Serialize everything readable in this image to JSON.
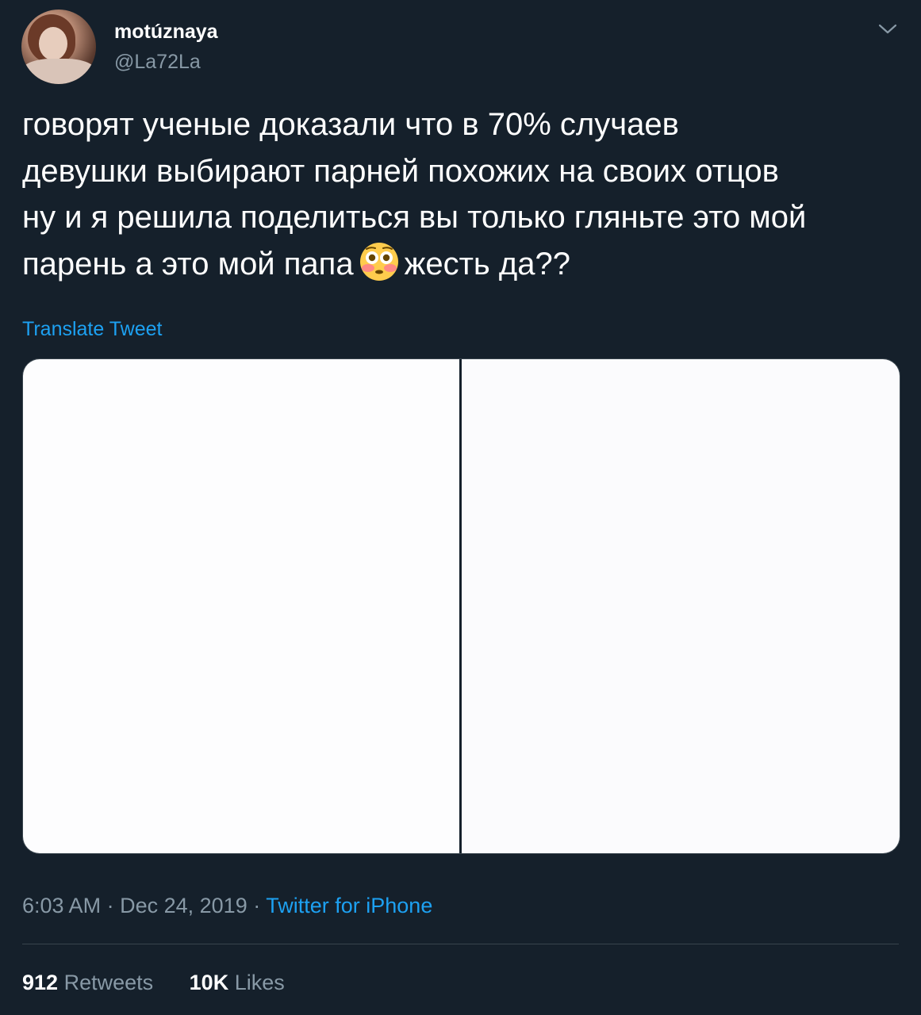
{
  "user": {
    "display_name": "motúznaya",
    "handle": "@La72La"
  },
  "tweet": {
    "lines": [
      "говорят ученые доказали что в 70% случаев",
      "девушки выбирают парней похожих на своих отцов",
      "ну и я решила поделиться вы только гляньте это мой",
      "парень а это мой папа"
    ],
    "line4_suffix": "жесть да??",
    "emoji": "flushed-face"
  },
  "translate_label": "Translate Tweet",
  "meta": {
    "time": "6:03 AM",
    "separator": "·",
    "date": "Dec 24, 2019",
    "source": "Twitter for iPhone"
  },
  "stats": {
    "retweets_count": "912",
    "retweets_label": "Retweets",
    "likes_count": "10K",
    "likes_label": "Likes"
  },
  "colors": {
    "background": "#15202b",
    "accent": "#1da1f2",
    "secondary_text": "#8899a6",
    "border": "#38444d"
  },
  "icons": {
    "menu": "chevron-down-icon"
  }
}
